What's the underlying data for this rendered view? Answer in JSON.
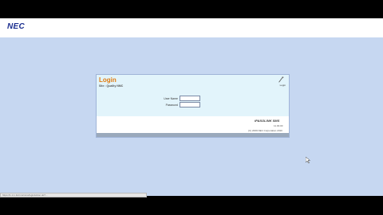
{
  "brand": {
    "logo": "NEC"
  },
  "login": {
    "title": "Login",
    "subtitle": "Site : Quality NMC",
    "icon_label": "Login",
    "username_label": "User Name",
    "password_label": "Password",
    "username_value": "",
    "password_value": ""
  },
  "footer": {
    "product": "iPASOLINK SMS",
    "version": "11.00.00",
    "copyright": "(C) 2009 NEC Corporation 2010"
  },
  "statusbar": {
    "url": "https://1.1.1.11/nms/nms/loginAction.do?..."
  },
  "colors": {
    "accent": "#e07b10",
    "logo": "#1b2e8f",
    "background": "#c6d7f1"
  }
}
